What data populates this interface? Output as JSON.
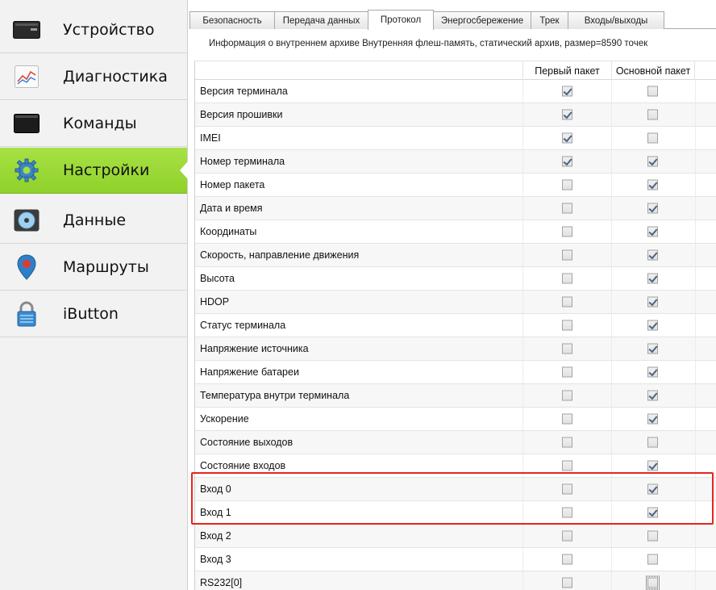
{
  "sidebar": {
    "items": [
      {
        "label": "Устройство",
        "icon": "device-icon"
      },
      {
        "label": "Диагностика",
        "icon": "diagnostics-chart-icon"
      },
      {
        "label": "Команды",
        "icon": "terminal-icon"
      },
      {
        "label": "Настройки",
        "icon": "gear-icon",
        "active": true
      },
      {
        "label": "Данные",
        "icon": "data-disk-icon"
      },
      {
        "label": "Маршруты",
        "icon": "map-pin-icon"
      },
      {
        "label": "iButton",
        "icon": "lock-icon"
      }
    ],
    "active_color": "#8fd12b"
  },
  "tabs": [
    {
      "label": "Безопасность"
    },
    {
      "label": "Передача данных"
    },
    {
      "label": "Протокол",
      "active": true
    },
    {
      "label": "Энергосбережение"
    },
    {
      "label": "Трек"
    },
    {
      "label": "Входы/выходы"
    }
  ],
  "archive_info": "Информация о внутреннем архиве  Внутренняя флеш-память, статический архив, размер=8590 точек",
  "table": {
    "headers": {
      "first_packet": "Первый пакет",
      "main_packet": "Основной пакет"
    },
    "rows": [
      {
        "name": "Версия терминала",
        "first": true,
        "main": false
      },
      {
        "name": "Версия прошивки",
        "first": true,
        "main": false
      },
      {
        "name": "IMEI",
        "first": true,
        "main": false
      },
      {
        "name": "Номер терминала",
        "first": true,
        "main": true
      },
      {
        "name": "Номер пакета",
        "first": false,
        "main": true
      },
      {
        "name": "Дата и время",
        "first": false,
        "main": true
      },
      {
        "name": "Координаты",
        "first": false,
        "main": true
      },
      {
        "name": "Скорость, направление движения",
        "first": false,
        "main": true
      },
      {
        "name": "Высота",
        "first": false,
        "main": true
      },
      {
        "name": "HDOP",
        "first": false,
        "main": true
      },
      {
        "name": "Статус терминала",
        "first": false,
        "main": true
      },
      {
        "name": "Напряжение источника",
        "first": false,
        "main": true
      },
      {
        "name": "Напряжение батареи",
        "first": false,
        "main": true
      },
      {
        "name": "Температура внутри терминала",
        "first": false,
        "main": true
      },
      {
        "name": "Ускорение",
        "first": false,
        "main": true
      },
      {
        "name": "Состояние выходов",
        "first": false,
        "main": false
      },
      {
        "name": "Состояние входов",
        "first": false,
        "main": true
      },
      {
        "name": "Вход 0",
        "first": false,
        "main": true
      },
      {
        "name": "Вход 1",
        "first": false,
        "main": true
      },
      {
        "name": "Вход 2",
        "first": false,
        "main": false
      },
      {
        "name": "Вход 3",
        "first": false,
        "main": false
      },
      {
        "name": "RS232[0]",
        "first": false,
        "main": false,
        "main_focused": true
      }
    ]
  },
  "highlight_color": "#e2261f"
}
